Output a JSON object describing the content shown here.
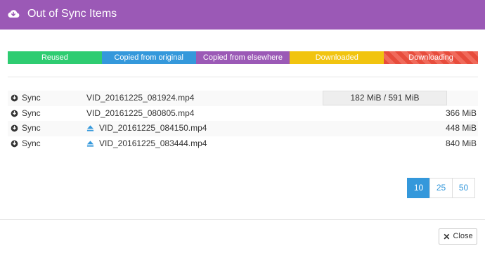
{
  "dialog": {
    "title": "Out of Sync Items",
    "header_icon": "cloud-download-icon",
    "header_color": "#9b59b6"
  },
  "legend": [
    {
      "label": "Reused",
      "color": "#2ecc71"
    },
    {
      "label": "Copied from original",
      "color": "#3498db"
    },
    {
      "label": "Copied from elsewhere",
      "color": "#9b59b6"
    },
    {
      "label": "Downloaded",
      "color": "#f1c40f"
    },
    {
      "label": "Downloading",
      "color": "#e74c3c"
    }
  ],
  "rows": [
    {
      "action": "Sync",
      "name": "VID_20161225_081924.mp4",
      "size": "182 MiB / 591 MiB",
      "progress": 0.31,
      "has_eject_icon": false
    },
    {
      "action": "Sync",
      "name": "VID_20161225_080805.mp4",
      "size": "366 MiB",
      "has_eject_icon": false
    },
    {
      "action": "Sync",
      "name": "VID_20161225_084150.mp4",
      "size": "448 MiB",
      "has_eject_icon": true
    },
    {
      "action": "Sync",
      "name": "VID_20161225_083444.mp4",
      "size": "840 MiB",
      "has_eject_icon": true
    }
  ],
  "pager": {
    "options": [
      "10",
      "25",
      "50"
    ],
    "active": "10",
    "accent": "#3498db"
  },
  "footer": {
    "close_label": "Close",
    "close_icon": "close-icon"
  }
}
